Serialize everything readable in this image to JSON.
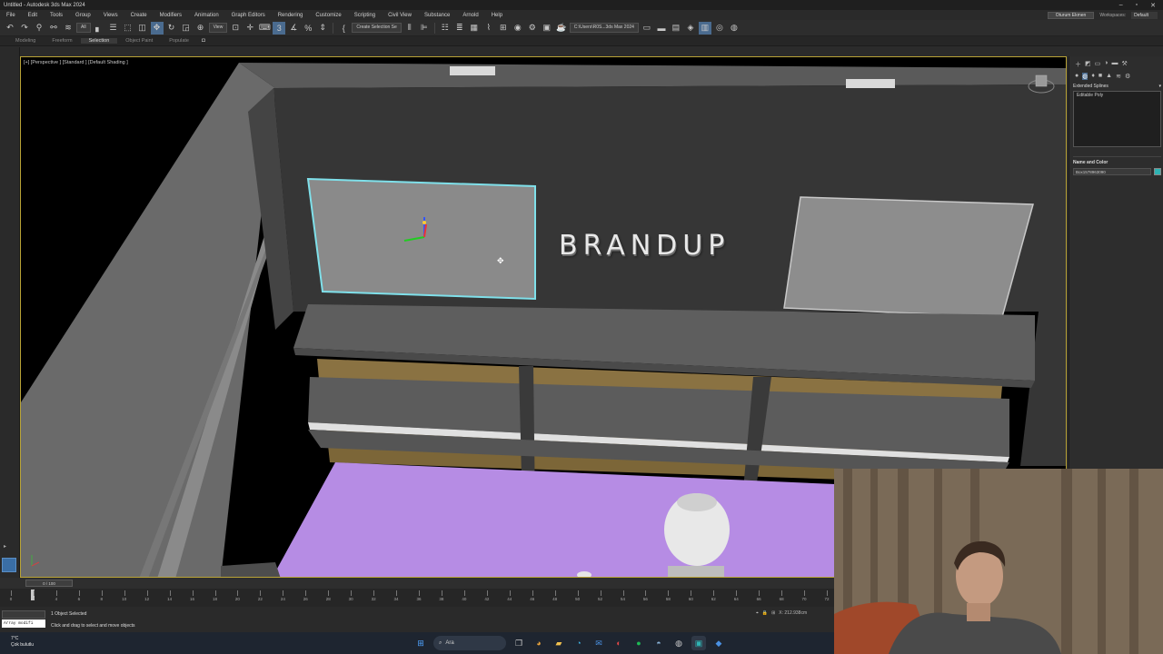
{
  "window": {
    "title": "Untitled - Autodesk 3ds Max 2024",
    "buttons": [
      "–",
      "▫",
      "✕"
    ]
  },
  "menu": {
    "items": [
      "File",
      "Edit",
      "Tools",
      "Group",
      "Views",
      "Create",
      "Modifiers",
      "Animation",
      "Graph Editors",
      "Rendering",
      "Customize",
      "Scripting",
      "Civil View",
      "Substance",
      "Arnold",
      "Help"
    ],
    "signin": "Oturum Ekmen",
    "workspaces_label": "Workspaces:",
    "workspaces_value": "Default"
  },
  "toolbar": {
    "filter_value": "All",
    "refcoord_value": "View",
    "selection_set_placeholder": "Create Selection Se",
    "project_path": "C:\\Users\\R0S...3ds Max 2024"
  },
  "ribbon": {
    "tabs": [
      "Modeling",
      "Freeform",
      "Selection",
      "Object Paint",
      "Populate"
    ],
    "selected": "Selection"
  },
  "viewport": {
    "label": "[+] [Perspective ] [Standard ] [Default Shading ]",
    "brand_text": "BRANDUP"
  },
  "command_panel": {
    "category": "Extended Splines",
    "stack_item": "Editable Poly",
    "rollup_title": "Name and Color",
    "object_name": "Box1578963090",
    "object_color": "#2fb3b3"
  },
  "timeline": {
    "slider_text": "0 / 100",
    "ticks": [
      "0",
      "2",
      "4",
      "6",
      "8",
      "10",
      "12",
      "14",
      "16",
      "18",
      "20",
      "22",
      "24",
      "26",
      "28",
      "30",
      "32",
      "34",
      "36",
      "38",
      "40",
      "42",
      "44",
      "46",
      "48",
      "50",
      "52",
      "54",
      "56",
      "58",
      "60",
      "62",
      "64",
      "66",
      "68",
      "70",
      "72"
    ]
  },
  "status": {
    "maxscript_text": "Array modifi",
    "selected_text": "1 Object Selected",
    "prompt_text": "Click and drag to select and move objects",
    "coord_text": "X: 212.938cm"
  },
  "taskbar": {
    "weather_temp": "7°C",
    "weather_desc": "Çok bulutlu",
    "search_placeholder": "Ara"
  }
}
